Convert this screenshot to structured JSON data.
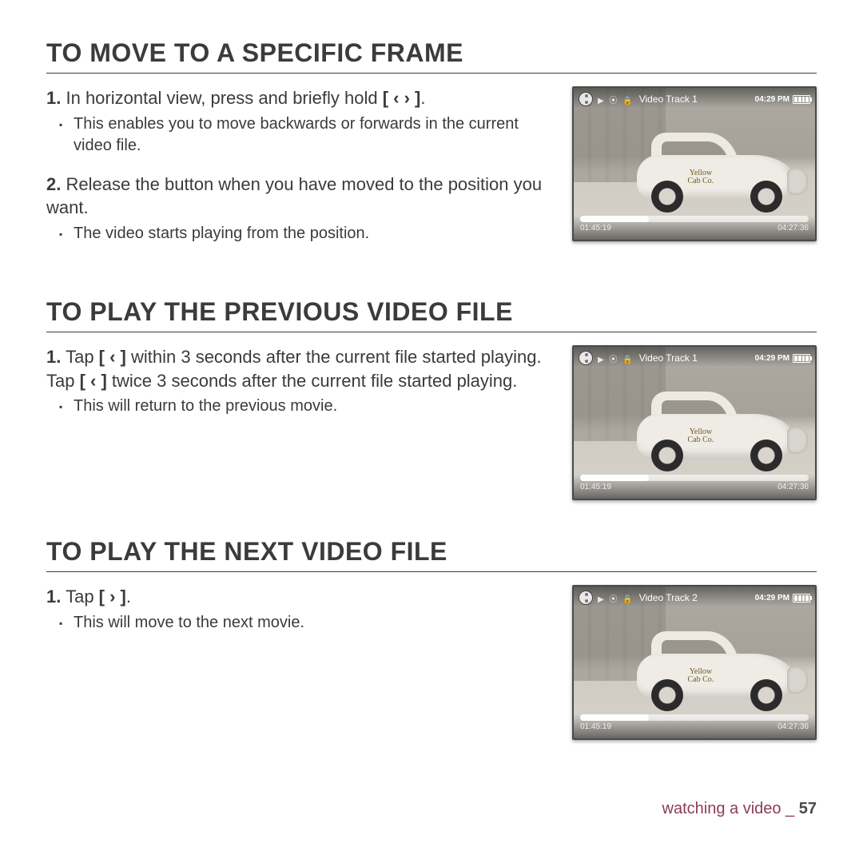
{
  "sections": [
    {
      "heading": "TO MOVE TO A SPECIFIC FRAME",
      "steps": [
        {
          "num": "1.",
          "text_before": "In horizontal view, press and briefly hold ",
          "button": "[ ‹  › ]",
          "text_after": ".",
          "sub": "This enables you to move backwards or forwards in the current video file."
        },
        {
          "num": "2.",
          "text_before": "Release the button when you have moved to the position you want.",
          "button": "",
          "text_after": "",
          "sub": "The video starts playing from the position."
        }
      ],
      "thumb": {
        "title": "Video Track 1",
        "clock": "04:29 PM",
        "t_left": "01:45:19",
        "t_right": "04:27:36"
      }
    },
    {
      "heading": "TO PLAY THE PREVIOUS VIDEO FILE",
      "steps": [
        {
          "num": "1.",
          "text_before": "Tap ",
          "button": "[ ‹ ]",
          "text_after": " within 3 seconds after the current file started playing.",
          "line2_before": "Tap ",
          "line2_button": "[ ‹ ]",
          "line2_after": " twice 3 seconds after the current file started playing.",
          "sub": "This will return to the previous movie."
        }
      ],
      "thumb": {
        "title": "Video Track 1",
        "clock": "04:29 PM",
        "t_left": "01:45:19",
        "t_right": "04:27:36"
      }
    },
    {
      "heading": "TO PLAY THE NEXT VIDEO FILE",
      "steps": [
        {
          "num": "1.",
          "text_before": "Tap ",
          "button": "[ › ]",
          "text_after": ".",
          "sub": "This will move to the next movie."
        }
      ],
      "thumb": {
        "title": "Video Track 2",
        "clock": "04:29 PM",
        "t_left": "01:45:19",
        "t_right": "04:27:36"
      }
    }
  ],
  "car_label_line1": "Yellow",
  "car_label_line2": "Cab Co.",
  "footer_text": "watching a video _ ",
  "page_number": "57"
}
